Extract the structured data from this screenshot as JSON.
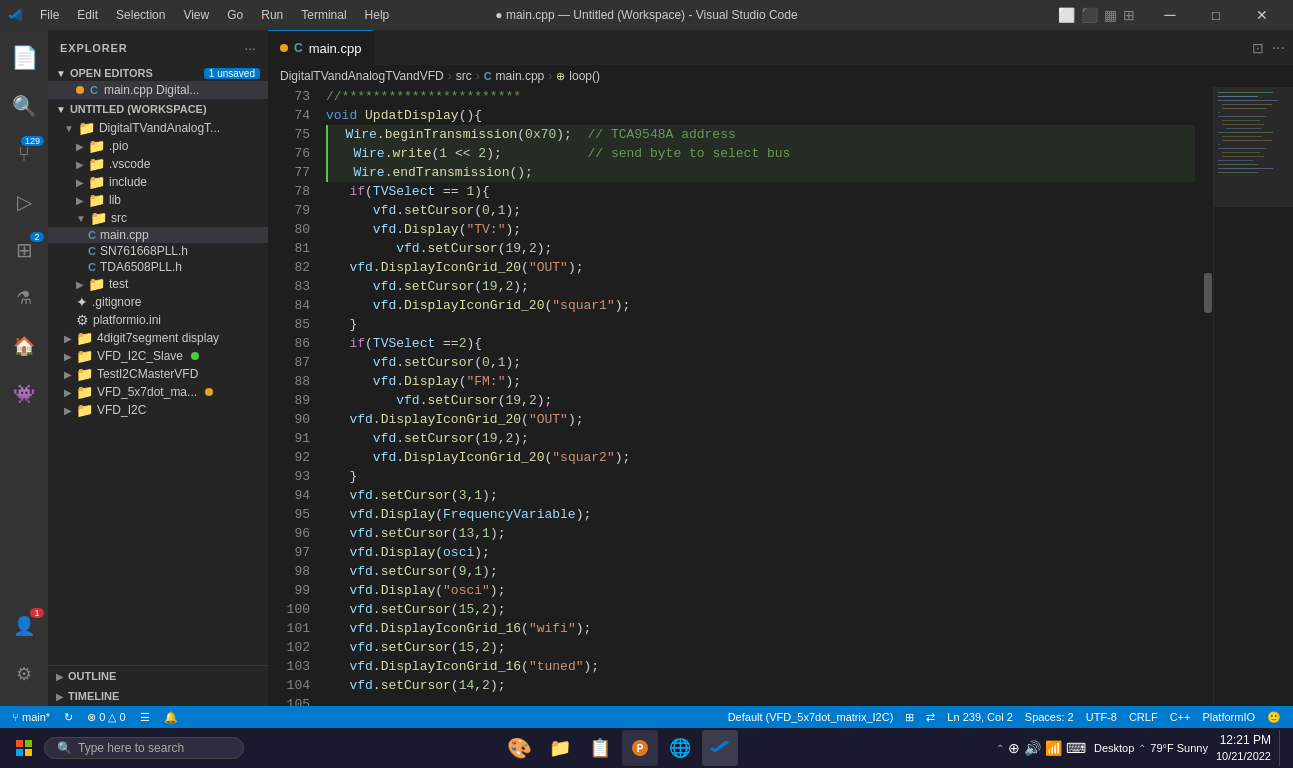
{
  "titlebar": {
    "logo": "vscode-logo",
    "menu": [
      "File",
      "Edit",
      "Selection",
      "View",
      "Go",
      "Run",
      "Terminal",
      "Help"
    ],
    "title": "● main.cpp — Untitled (Workspace) - Visual Studio Code",
    "buttons": [
      "minimize",
      "maximize",
      "tile",
      "close"
    ]
  },
  "tab": {
    "icon_color": "#e8a020",
    "filename": "main.cpp",
    "dot": true
  },
  "breadcrumb": {
    "parts": [
      "DigitalTVandAnalogTVandVFD",
      "src",
      "main.cpp",
      "loop()"
    ]
  },
  "sidebar": {
    "explorer_title": "EXPLORER",
    "open_editors_label": "OPEN EDITORS",
    "unsaved_count": "1 unsaved",
    "editor_file": "main.cpp Digital...",
    "workspace_label": "UNTITLED (WORKSPACE)",
    "tree": [
      {
        "label": "DigitalTVandAnalogT...",
        "indent": 1,
        "type": "folder",
        "open": true
      },
      {
        "label": ".pio",
        "indent": 2,
        "type": "folder"
      },
      {
        "label": ".vscode",
        "indent": 2,
        "type": "folder"
      },
      {
        "label": "include",
        "indent": 2,
        "type": "folder"
      },
      {
        "label": "lib",
        "indent": 2,
        "type": "folder"
      },
      {
        "label": "src",
        "indent": 2,
        "type": "folder",
        "open": true
      },
      {
        "label": "main.cpp",
        "indent": 3,
        "type": "file",
        "active": true
      },
      {
        "label": "SN761668PLL.h",
        "indent": 3,
        "type": "file"
      },
      {
        "label": "TDA6508PLL.h",
        "indent": 3,
        "type": "file"
      },
      {
        "label": "test",
        "indent": 2,
        "type": "folder"
      },
      {
        "label": ".gitignore",
        "indent": 2,
        "type": "file"
      },
      {
        "label": "platformio.ini",
        "indent": 2,
        "type": "file"
      },
      {
        "label": "4digit7segment display",
        "indent": 1,
        "type": "folder"
      },
      {
        "label": "VFD_I2C_Slave",
        "indent": 1,
        "type": "folder",
        "dot": true
      },
      {
        "label": "TestI2CMasterVFD",
        "indent": 1,
        "type": "folder"
      },
      {
        "label": "VFD_5x7dot_ma...",
        "indent": 1,
        "type": "folder",
        "dot2": true
      },
      {
        "label": "VFD_I2C",
        "indent": 1,
        "type": "folder"
      }
    ],
    "outline_label": "OUTLINE",
    "timeline_label": "TIMELINE"
  },
  "activity": {
    "icons": [
      {
        "name": "explorer",
        "active": true,
        "badge": null
      },
      {
        "name": "search",
        "active": false,
        "badge": null
      },
      {
        "name": "source-control",
        "active": false,
        "badge": "129"
      },
      {
        "name": "run-debug",
        "active": false,
        "badge": null
      },
      {
        "name": "extensions",
        "active": false,
        "badge": "2"
      },
      {
        "name": "testing",
        "active": false,
        "badge": null
      },
      {
        "name": "platformio",
        "active": false,
        "badge": null
      },
      {
        "name": "alien",
        "active": false,
        "badge": null
      },
      {
        "name": "account",
        "active": false,
        "badge": "1"
      },
      {
        "name": "settings",
        "active": false,
        "badge": null
      }
    ]
  },
  "code": {
    "lines": [
      {
        "n": 73,
        "text": "//***********************"
      },
      {
        "n": 74,
        "text": "void UpdatDisplay(){"
      },
      {
        "n": 75,
        "text": "  Wire.beginTransmission(0x70);  // TCA9548A address"
      },
      {
        "n": 76,
        "text": "   Wire.write(1 << 2);           // send byte to select bus"
      },
      {
        "n": 77,
        "text": "   Wire.endTransmission();"
      },
      {
        "n": 78,
        "text": ""
      },
      {
        "n": 79,
        "text": "   if(TVSelect == 1){"
      },
      {
        "n": 80,
        "text": "      vfd.setCursor(0,1);"
      },
      {
        "n": 81,
        "text": "      vfd.Display(\"TV:\");"
      },
      {
        "n": 82,
        "text": "         vfd.setCursor(19,2);"
      },
      {
        "n": 83,
        "text": "   vfd.DisplayIconGrid_20(\"OUT\");"
      },
      {
        "n": 84,
        "text": "      vfd.setCursor(19,2);"
      },
      {
        "n": 85,
        "text": "      vfd.DisplayIconGrid_20(\"squar1\");"
      },
      {
        "n": 86,
        "text": "   }"
      },
      {
        "n": 87,
        "text": "   if(TVSelect ==2){"
      },
      {
        "n": 88,
        "text": "      vfd.setCursor(0,1);"
      },
      {
        "n": 89,
        "text": "      vfd.Display(\"FM:\");"
      },
      {
        "n": 90,
        "text": "         vfd.setCursor(19,2);"
      },
      {
        "n": 91,
        "text": "   vfd.DisplayIconGrid_20(\"OUT\");"
      },
      {
        "n": 92,
        "text": "      vfd.setCursor(19,2);"
      },
      {
        "n": 93,
        "text": "      vfd.DisplayIconGrid_20(\"squar2\");"
      },
      {
        "n": 94,
        "text": "   }"
      },
      {
        "n": 95,
        "text": "   vfd.setCursor(3,1);"
      },
      {
        "n": 96,
        "text": "   vfd.Display(FrequencyVariable);"
      },
      {
        "n": 97,
        "text": "   vfd.setCursor(13,1);"
      },
      {
        "n": 98,
        "text": "   vfd.Display(osci);"
      },
      {
        "n": 99,
        "text": "   vfd.setCursor(9,1);"
      },
      {
        "n": 100,
        "text": "   vfd.Display(\"osci\");"
      },
      {
        "n": 101,
        "text": "   vfd.setCursor(15,2);"
      },
      {
        "n": 102,
        "text": "   vfd.DisplayIconGrid_16(\"wifi\");"
      },
      {
        "n": 103,
        "text": "   vfd.setCursor(15,2);"
      },
      {
        "n": 104,
        "text": "   vfd.DisplayIconGrid_16(\"tuned\");"
      },
      {
        "n": 105,
        "text": "   vfd.setCursor(14,2);"
      }
    ]
  },
  "statusbar": {
    "branch": "main*",
    "sync": "↻",
    "errors": "⊗ 0 △ 0",
    "profile": "☰",
    "bell": "🔔",
    "encoding": "Default (VFD_5x7dot_matrix_I2C)",
    "ln_col": "Ln 239, Col 2",
    "spaces": "Spaces: 2",
    "encoding2": "UTF-8",
    "line_ending": "CRLF",
    "language": "C++",
    "platformio": "PlatformIO",
    "feedback": "🙂"
  },
  "taskbar": {
    "start_label": "⊞",
    "search_placeholder": "Type here to search",
    "apps": [
      "🎨",
      "📁",
      "📋",
      "🔵",
      "🌐",
      "💙"
    ],
    "time": "12:21 PM",
    "date": "10/21/2022",
    "desktop": "Desktop",
    "weather": "79°F  Sunny"
  }
}
